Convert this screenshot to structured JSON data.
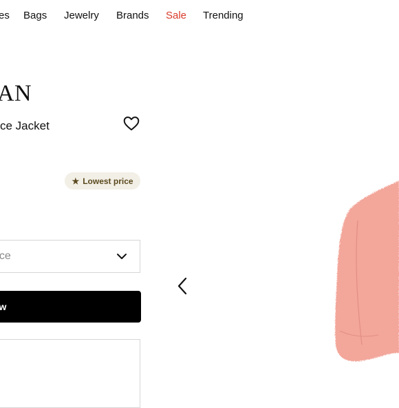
{
  "nav": {
    "items": [
      {
        "label": "es"
      },
      {
        "label": "Bags"
      },
      {
        "label": "Jewelry"
      },
      {
        "label": "Brands"
      },
      {
        "label": "Sale"
      },
      {
        "label": "Trending"
      }
    ]
  },
  "product": {
    "brand": "AN",
    "name": "ce Jacket",
    "badge_label": "Lowest price"
  },
  "size_select": {
    "value": "rice"
  },
  "buy_button": {
    "label": "ow"
  },
  "colors": {
    "sale": "#d83a2a",
    "badge_bg": "#f2efe6",
    "badge_text": "#5b4a1f",
    "button_bg": "#000000",
    "jacket": "#f3a69a"
  },
  "icons": {
    "wishlist": "heart-outline-icon",
    "select_chevron": "chevron-down-icon",
    "carousel_prev": "chevron-left-icon",
    "badge": "star-icon"
  }
}
